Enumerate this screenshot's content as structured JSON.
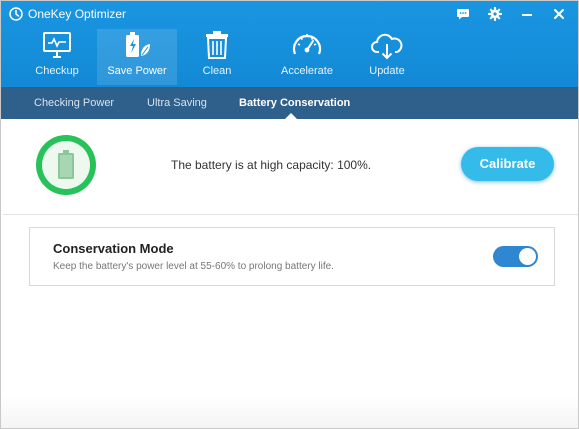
{
  "app": {
    "title": "OneKey Optimizer",
    "logo_icon": "onekey-logo-icon",
    "title_buttons": [
      "feedback-icon",
      "settings-icon",
      "minimize-icon",
      "close-icon"
    ]
  },
  "colors": {
    "header_blue": "#1a95e0",
    "subnav_blue": "#2f5f8b",
    "battery_green": "#27c35a",
    "calibrate_blue": "#34bbea",
    "toggle_on": "#2f86d1"
  },
  "nav": {
    "items": [
      {
        "label": "Checkup",
        "icon": "monitor-check-icon"
      },
      {
        "label": "Save Power",
        "icon": "battery-leaf-icon",
        "active": true
      },
      {
        "label": "Clean",
        "icon": "trash-icon"
      },
      {
        "label": "Accelerate",
        "icon": "speedometer-icon"
      },
      {
        "label": "Update",
        "icon": "cloud-download-icon"
      }
    ]
  },
  "subtabs": {
    "items": [
      {
        "label": "Checking Power"
      },
      {
        "label": "Ultra Saving"
      },
      {
        "label": "Battery Conservation",
        "active": true
      }
    ]
  },
  "battery": {
    "status_text": "The battery is at high capacity: 100%.",
    "level_percent": 100,
    "calibrate_label": "Calibrate"
  },
  "conservation": {
    "title": "Conservation Mode",
    "description": "Keep the battery's power level at 55-60% to prolong battery life.",
    "enabled": true
  }
}
